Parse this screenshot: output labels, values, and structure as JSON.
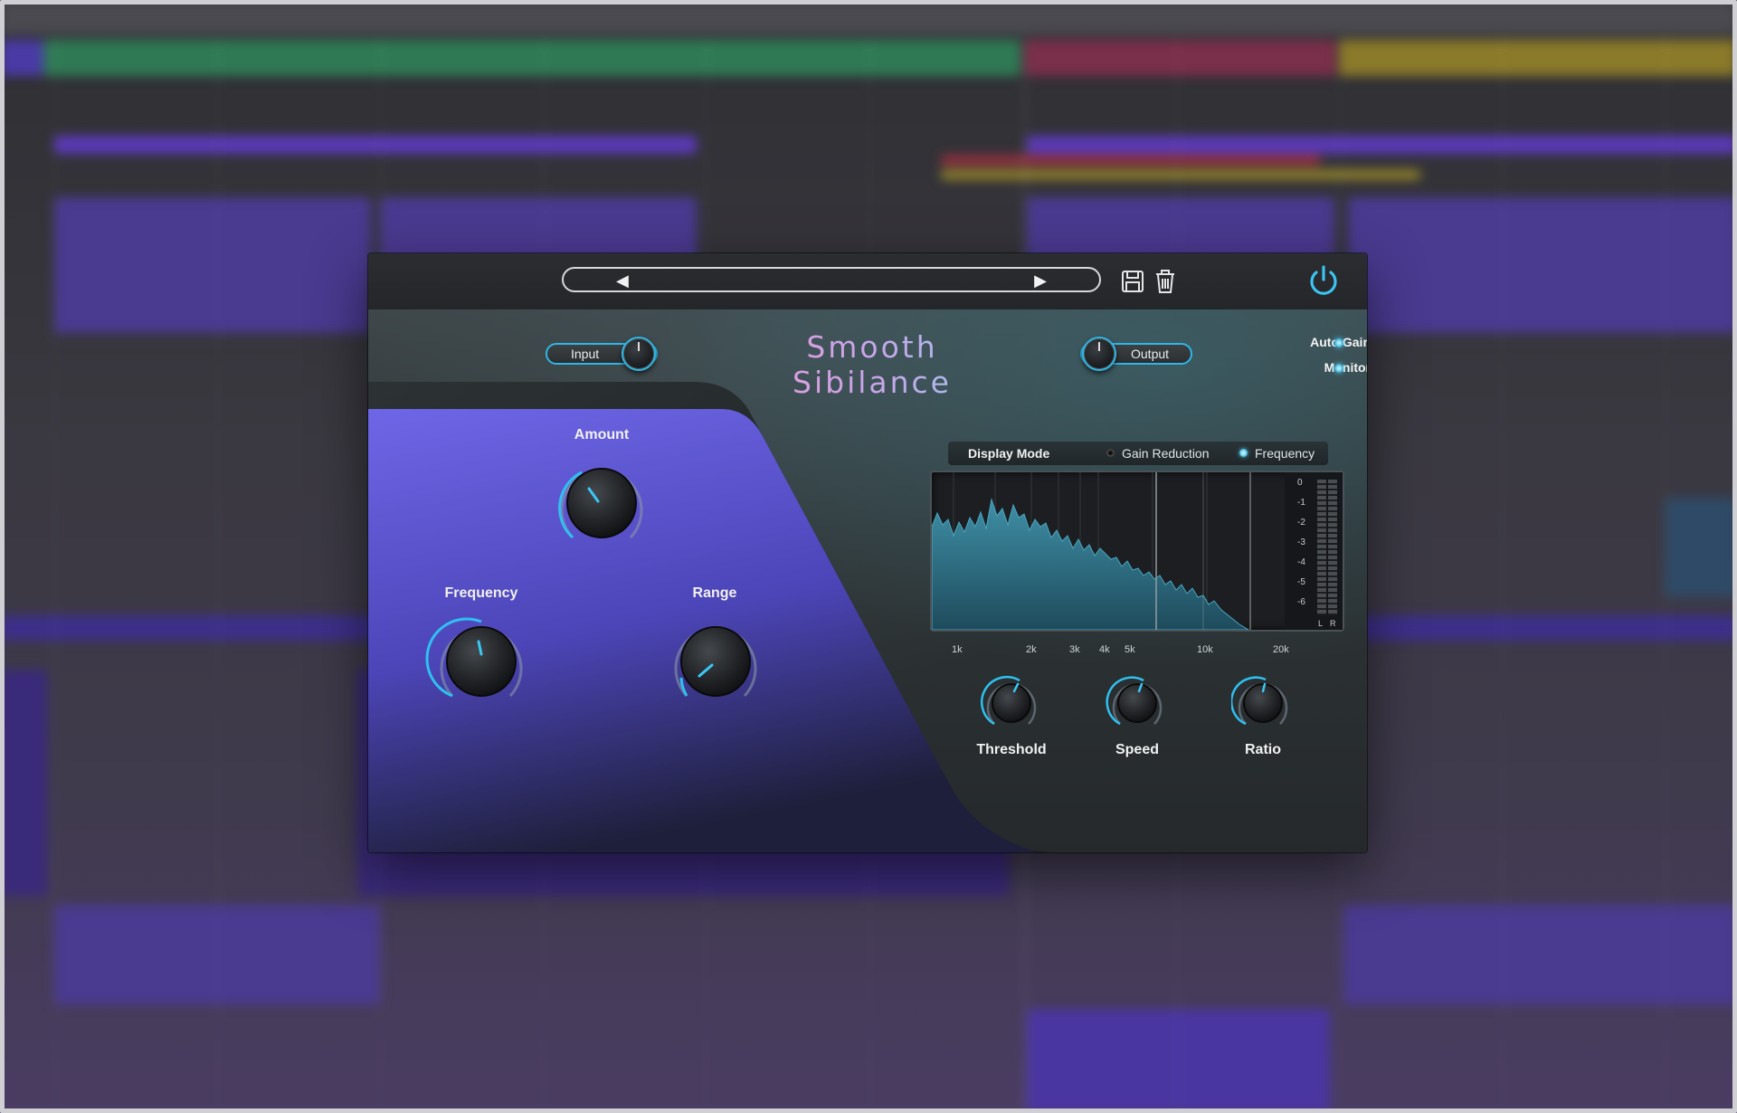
{
  "plugin": {
    "title": "Smooth Sibilance",
    "topbar": {
      "prev_icon": "chevron-left-icon",
      "next_icon": "chevron-right-icon",
      "save_icon": "floppy-disk-icon",
      "delete_icon": "trash-icon",
      "power_icon": "power-icon",
      "preset_name": ""
    },
    "io": {
      "input_label": "Input",
      "output_label": "Output"
    },
    "toggles": {
      "auto_gain_label": "Auto Gain",
      "monitor_label": "Monitor"
    },
    "main_knobs": {
      "amount_label": "Amount",
      "frequency_label": "Frequency",
      "range_label": "Range"
    },
    "display": {
      "mode_label": "Display Mode",
      "options": [
        "Gain Reduction",
        "Frequency"
      ],
      "selected": "Frequency",
      "freq_ticks": [
        "1k",
        "2k",
        "3k",
        "4k",
        "5k",
        "10k",
        "20k"
      ],
      "meter_ticks": [
        "0",
        "-1",
        "-2",
        "-3",
        "-4",
        "-5",
        "-6"
      ],
      "meter_left": "L",
      "meter_right": "R"
    },
    "detector_knobs": {
      "threshold_label": "Threshold",
      "speed_label": "Speed",
      "ratio_label": "Ratio"
    },
    "colors": {
      "accent": "#2fb6e6",
      "purple": "#5a4fd6",
      "title_gradient_start": "#e49ad8",
      "title_gradient_end": "#9cc6ec"
    }
  }
}
